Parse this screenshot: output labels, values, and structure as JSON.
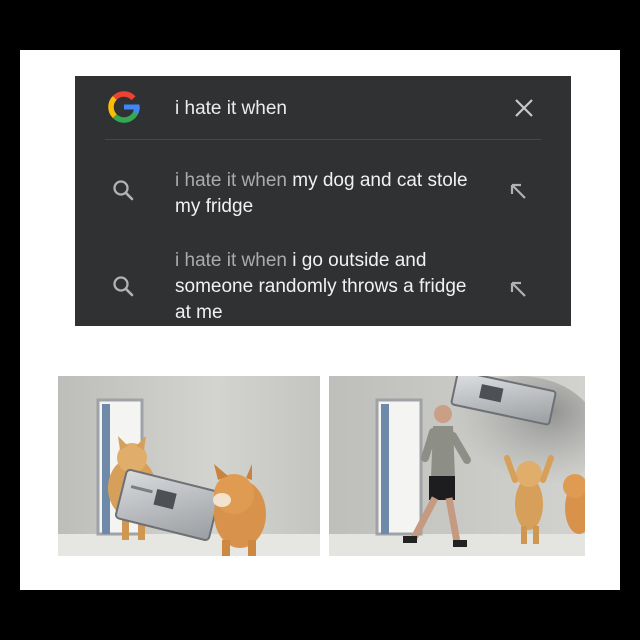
{
  "search": {
    "query": "i hate it when",
    "suggestions": [
      {
        "prefix": "i hate it when ",
        "rest": "my dog and cat stole my fridge"
      },
      {
        "prefix": "i hate it when ",
        "rest": "i go outside and someone randomly throws a fridge at me"
      }
    ]
  },
  "icons": {
    "logo": "google-g-icon",
    "clear": "close-icon",
    "suggestion": "search-icon",
    "fill": "arrow-up-left-icon"
  },
  "colors": {
    "panel": "#2f3133",
    "text": "#f1f1f1",
    "muted": "#a9abad"
  }
}
